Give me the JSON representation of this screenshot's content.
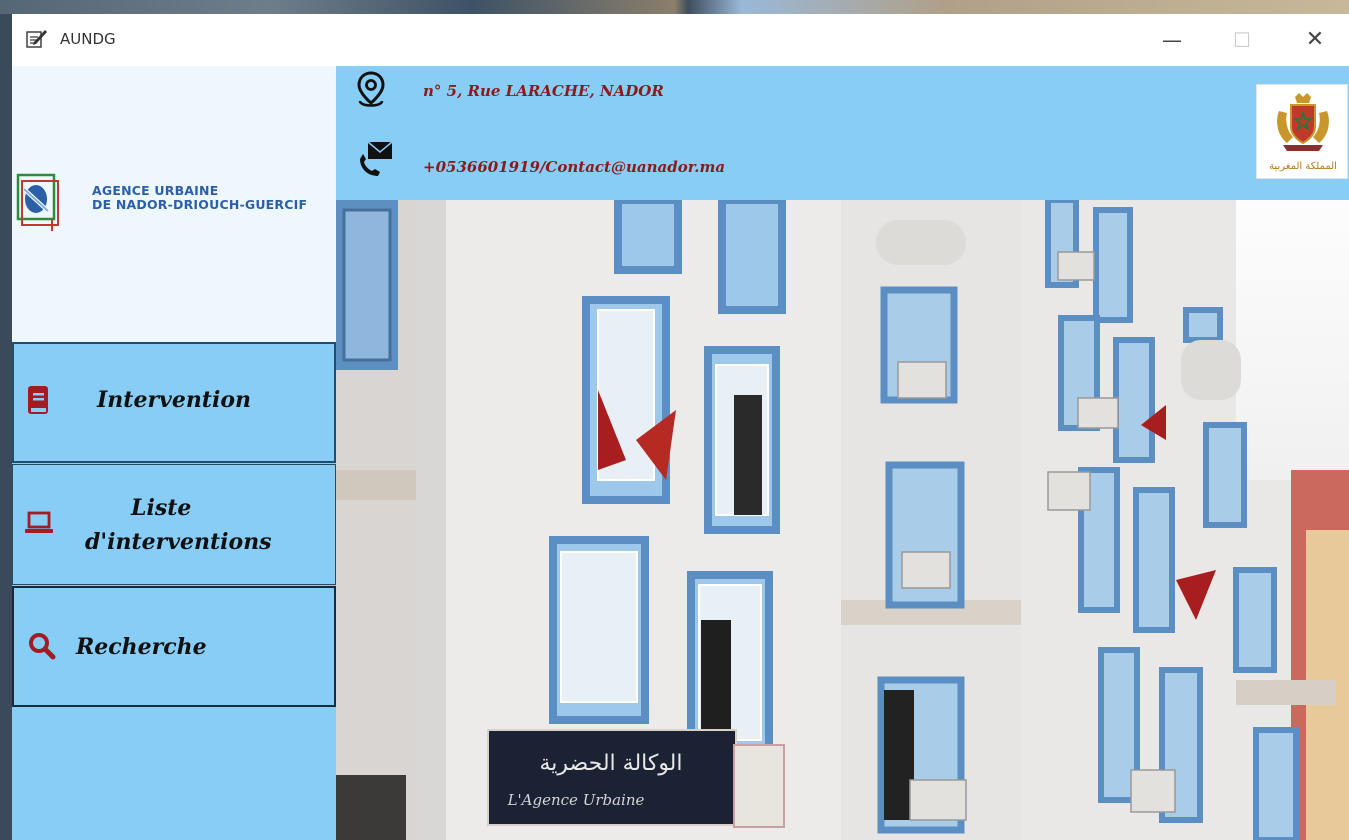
{
  "window": {
    "title": "AUNDG",
    "controls": {
      "minimize": "—",
      "maximize": "☐",
      "close": "✕"
    }
  },
  "sidebar": {
    "logo": {
      "line1": "AGENCE URBAINE",
      "line2": "DE NADOR-DRIOUCH-GUERCIF"
    },
    "items": [
      {
        "label": "Intervention",
        "icon": "book-icon"
      },
      {
        "label_line1": "Liste",
        "label_line2": "d'interventions",
        "icon": "laptop-icon"
      },
      {
        "label": "Recherche",
        "icon": "search-icon"
      }
    ]
  },
  "header": {
    "address": "n° 5, Rue LARACHE, NADOR",
    "contact": "+0536601919/Contact@uanador.ma",
    "emblem_caption": "المملكة المغربية"
  },
  "photo": {
    "sign_arabic": "الوكالة الحضرية",
    "sign_french": "L'Agence Urbaine"
  },
  "colors": {
    "accent": "#87cdf6",
    "text_dark_red": "#8b1a1a",
    "icon_red": "#a21c24",
    "logo_blue": "#2b5fa8"
  }
}
